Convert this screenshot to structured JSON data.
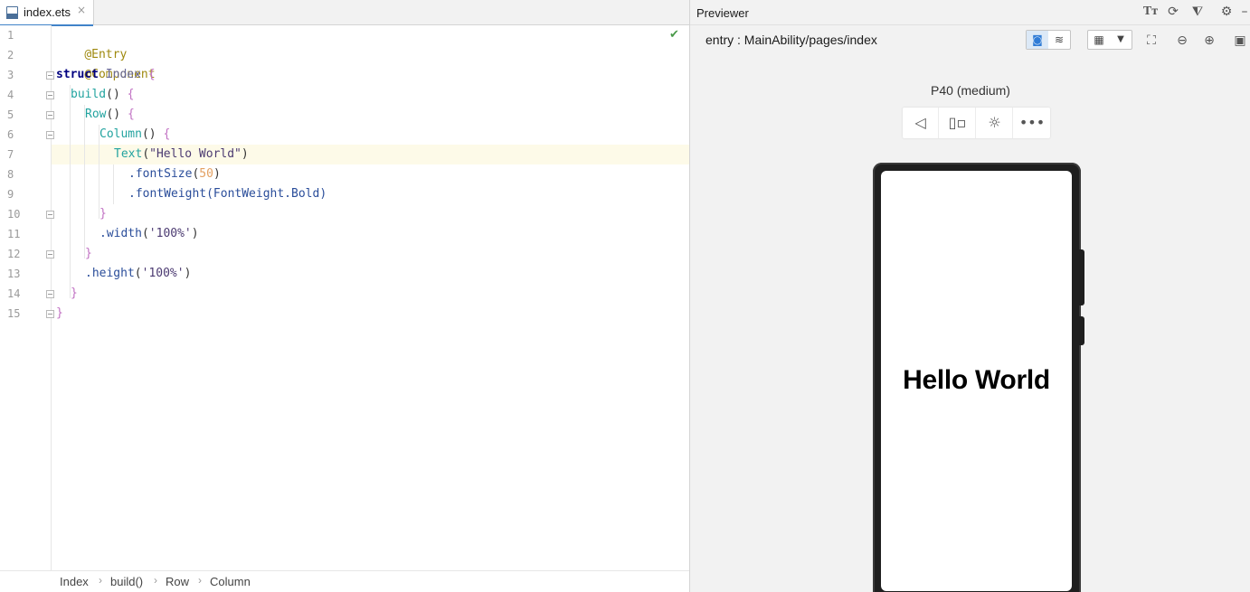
{
  "editor": {
    "tab_name": "index.ets",
    "tab_close": "×",
    "line_numbers": [
      "1",
      "2",
      "3",
      "4",
      "5",
      "6",
      "7",
      "8",
      "9",
      "10",
      "11",
      "12",
      "13",
      "14",
      "15"
    ],
    "code": {
      "l1": "@Entry",
      "l2": "@Component",
      "l3_kw": "struct",
      "l3_name": " Index ",
      "l3_brace": "{",
      "l4_fn": "build",
      "l4_paren": "() ",
      "l4_brace": "{",
      "l5_fn": "Row",
      "l5_paren": "() ",
      "l5_brace": "{",
      "l6_fn": "Column",
      "l6_paren": "() ",
      "l6_brace": "{",
      "l7_fn": "Text",
      "l7_open": "(",
      "l7_str": "\"Hello World\"",
      "l7_close": ")",
      "l8_method": ".fontSize",
      "l8_open": "(",
      "l8_num": "50",
      "l8_close": ")",
      "l9_method": ".fontWeight",
      "l9_arg": "(FontWeight.Bold)",
      "l10": "}",
      "l11_method": ".width",
      "l11_open": "(",
      "l11_str": "'100%'",
      "l11_close": ")",
      "l12": "}",
      "l13_method": ".height",
      "l13_open": "(",
      "l13_str": "'100%'",
      "l13_close": ")",
      "l14": "}",
      "l15": "}"
    },
    "breadcrumb": [
      "Index",
      "build()",
      "Row",
      "Column"
    ],
    "breadcrumb_sep": "›"
  },
  "previewer": {
    "title": "Previewer",
    "entry_path": "entry : MainAbility/pages/index",
    "device_name": "P40 (medium)",
    "screen_text": "Hello World",
    "header_icons": [
      "font-size-icon",
      "refresh-icon",
      "pin-icon",
      "gear-icon",
      "minimize-icon"
    ],
    "device_tools": [
      "back-icon",
      "rotate-icon",
      "brightness-icon",
      "more-icon"
    ]
  },
  "colors": {
    "accent": "#4083c9",
    "current_line": "#fdfae8",
    "annotation": "#9e880d",
    "keyword": "#000080",
    "function": "#22a39f",
    "string": "#4b3a71",
    "number": "#e3a062",
    "bracket": "#c171c3"
  }
}
